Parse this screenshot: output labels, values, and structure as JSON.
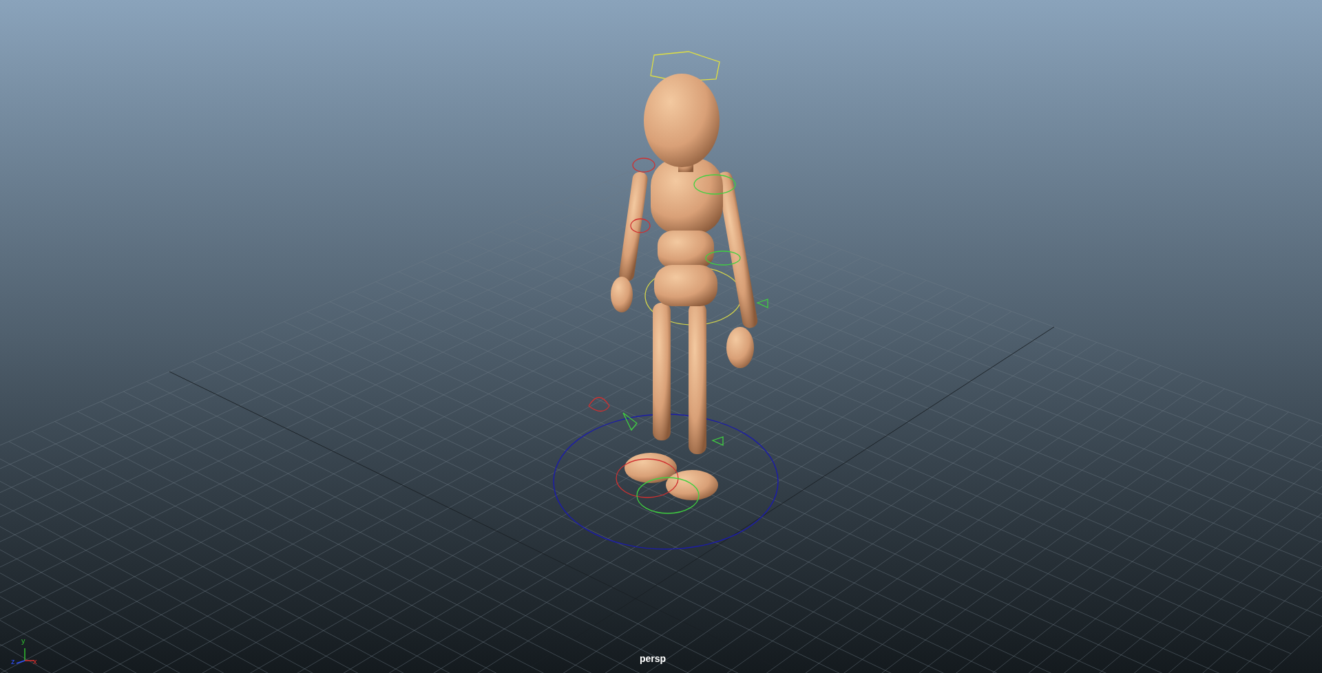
{
  "viewport": {
    "camera_label": "persp",
    "axis_labels": [
      {
        "axis": "y"
      },
      {
        "axis": "z"
      },
      {
        "axis": "x"
      }
    ]
  }
}
